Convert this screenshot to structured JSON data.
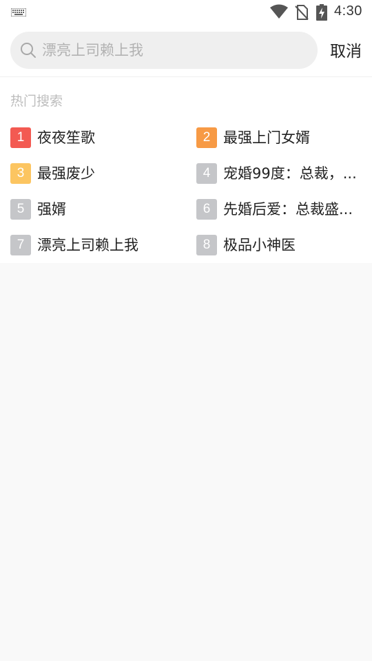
{
  "status_bar": {
    "time": "4:30",
    "icons": [
      "keyboard-icon",
      "wifi-icon",
      "no-sim-icon",
      "battery-charging-icon"
    ]
  },
  "search": {
    "placeholder": "漂亮上司赖上我",
    "value": "",
    "cancel_label": "取消"
  },
  "hot": {
    "title": "热门搜索",
    "items": [
      {
        "rank": "1",
        "title": "夜夜笙歌"
      },
      {
        "rank": "2",
        "title": "最强上门女婿"
      },
      {
        "rank": "3",
        "title": "最强废少"
      },
      {
        "rank": "4",
        "title": "宠婚99度：总裁，..."
      },
      {
        "rank": "5",
        "title": "强婿"
      },
      {
        "rank": "6",
        "title": "先婚后爱：总裁盛..."
      },
      {
        "rank": "7",
        "title": "漂亮上司赖上我"
      },
      {
        "rank": "8",
        "title": "极品小神医"
      }
    ]
  },
  "colors": {
    "rank_1": "#f35a52",
    "rank_2": "#f79a45",
    "rank_3": "#fcc561",
    "rank_other": "#c5c6c9",
    "background": "#f9f9f9",
    "search_bg": "#efefef"
  }
}
